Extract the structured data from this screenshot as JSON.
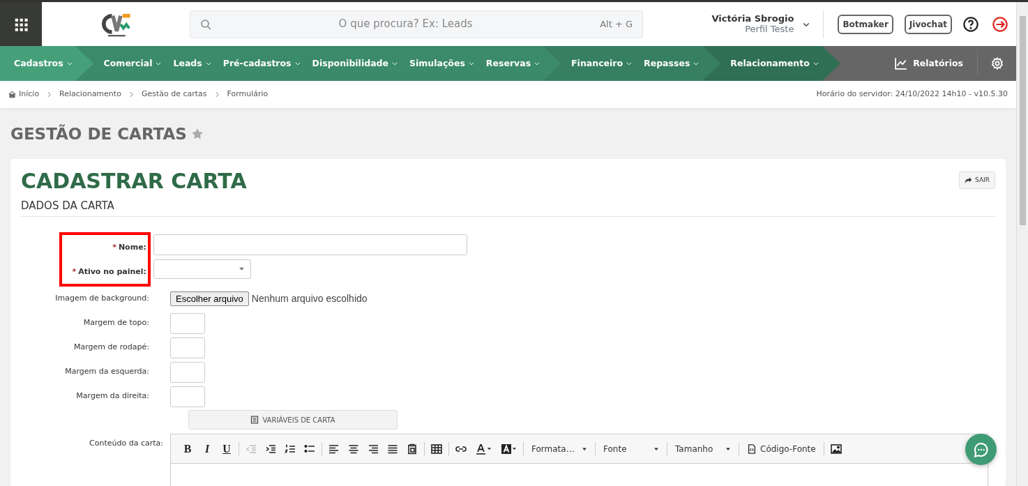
{
  "header": {
    "search": {
      "placeholder": "O que procura? Ex: Leads",
      "shortcut": "Alt + G"
    },
    "user": {
      "name": "Victória Sbrogio",
      "profile": "Perfil Teste"
    },
    "buttons": [
      "Botmaker",
      "Jivochat"
    ]
  },
  "nav": {
    "segments": [
      {
        "color": "#45a07a",
        "items": [
          "Cadastros"
        ]
      },
      {
        "color": "#3b8a69",
        "items": [
          "Comercial",
          "Leads",
          "Pré-cadastros",
          "Disponibilidade",
          "Simulações",
          "Reservas"
        ]
      },
      {
        "color": "#367f61",
        "items": [
          "Financeiro",
          "Repasses"
        ]
      },
      {
        "color": "#2f6f53",
        "items": [
          "Relacionamento"
        ]
      }
    ],
    "reports": "Relatórios"
  },
  "breadcrumb": [
    "Início",
    "Relacionamento",
    "Gestão de cartas",
    "Formulário"
  ],
  "server_time": "Horário do servidor: 24/10/2022 14h10 - v10.5.30",
  "page_title": "GESTÃO DE CARTAS",
  "favorite": false,
  "form": {
    "title": "CADASTRAR CARTA",
    "required_mark": "*",
    "exit_button": "SAIR",
    "section": "DADOS DA CARTA",
    "fields": [
      {
        "kind": "text",
        "label": "Nome:",
        "required": true,
        "highlighted": true
      },
      {
        "kind": "select",
        "label": "Ativo no painel:",
        "required": true,
        "highlighted": true
      },
      {
        "kind": "file",
        "label": "Imagem de background:",
        "required": false,
        "highlighted": false,
        "button": "Escolher arquivo",
        "status": "Nenhum arquivo escolhido"
      },
      {
        "kind": "small",
        "label": "Margem de topo:",
        "required": false,
        "highlighted": false
      },
      {
        "kind": "small",
        "label": "Margem de rodapé:",
        "required": false,
        "highlighted": false
      },
      {
        "kind": "small",
        "label": "Margem da esquerda:",
        "required": false,
        "highlighted": false
      },
      {
        "kind": "small",
        "label": "Margem da direita:",
        "required": false,
        "highlighted": false
      }
    ],
    "variables_button": "VARIÁVEIS DE CARTA",
    "editor": {
      "label": "Conteúdo da carta:",
      "toolbar": [
        {
          "kind": "char",
          "text": "B",
          "disabled": false
        },
        {
          "kind": "char",
          "text": "I",
          "disabled": false
        },
        {
          "kind": "char",
          "text": "U",
          "disabled": false
        },
        {
          "kind": "sep"
        },
        {
          "kind": "icon",
          "disabled": true
        },
        {
          "kind": "icon",
          "disabled": false
        },
        {
          "kind": "icon",
          "disabled": false
        },
        {
          "kind": "icon",
          "disabled": false
        },
        {
          "kind": "sep"
        },
        {
          "kind": "icon",
          "disabled": false
        },
        {
          "kind": "icon",
          "disabled": false
        },
        {
          "kind": "icon",
          "disabled": false
        },
        {
          "kind": "icon",
          "disabled": false
        },
        {
          "kind": "icon",
          "disabled": false
        },
        {
          "kind": "sep"
        },
        {
          "kind": "icon",
          "disabled": false
        },
        {
          "kind": "sep"
        },
        {
          "kind": "icon",
          "disabled": false
        },
        {
          "kind": "icon",
          "disabled": false
        },
        {
          "kind": "icon",
          "disabled": false
        },
        {
          "kind": "sep"
        },
        {
          "kind": "dropdown",
          "text": "Formata…"
        },
        {
          "kind": "sep"
        },
        {
          "kind": "dropdown",
          "text": "Fonte"
        },
        {
          "kind": "sep"
        },
        {
          "kind": "dropdown",
          "text": "Tamanho"
        },
        {
          "kind": "sep"
        },
        {
          "kind": "source",
          "text": "Código-Fonte"
        },
        {
          "kind": "sep"
        },
        {
          "kind": "icon",
          "disabled": false
        }
      ]
    }
  }
}
